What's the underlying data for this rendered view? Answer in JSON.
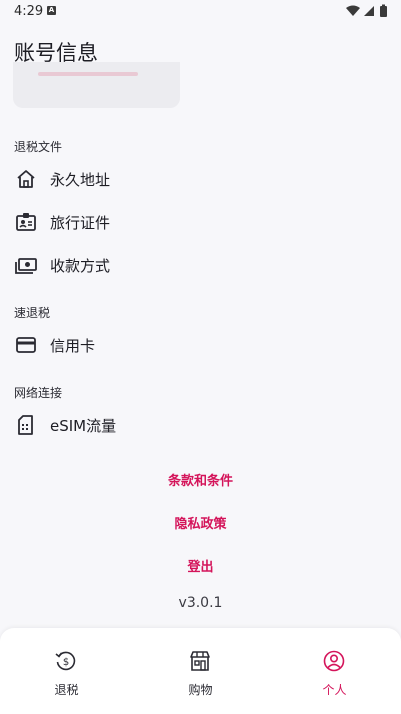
{
  "status_bar": {
    "time": "4:29",
    "notification_glyph": "A"
  },
  "header": {
    "title": "账号信息"
  },
  "sections": [
    {
      "label": "退税文件",
      "items": [
        {
          "label": "永久地址",
          "icon": "home-icon"
        },
        {
          "label": "旅行证件",
          "icon": "id-card-icon"
        },
        {
          "label": "收款方式",
          "icon": "cash-icon"
        }
      ]
    },
    {
      "label": "速退税",
      "items": [
        {
          "label": "信用卡",
          "icon": "credit-card-icon"
        }
      ]
    },
    {
      "label": "网络连接",
      "items": [
        {
          "label": "eSIM流量",
          "icon": "sim-card-icon"
        }
      ]
    }
  ],
  "links": {
    "terms": "条款和条件",
    "privacy": "隐私政策",
    "logout": "登出"
  },
  "version": "v3.0.1",
  "bottom_nav": [
    {
      "label": "退税",
      "icon": "tax-refund-icon",
      "active": false
    },
    {
      "label": "购物",
      "icon": "store-icon",
      "active": false
    },
    {
      "label": "个人",
      "icon": "profile-icon",
      "active": true
    }
  ],
  "colors": {
    "accent": "#d4145a",
    "background": "#f7f7fa",
    "text": "#1d1d24"
  }
}
